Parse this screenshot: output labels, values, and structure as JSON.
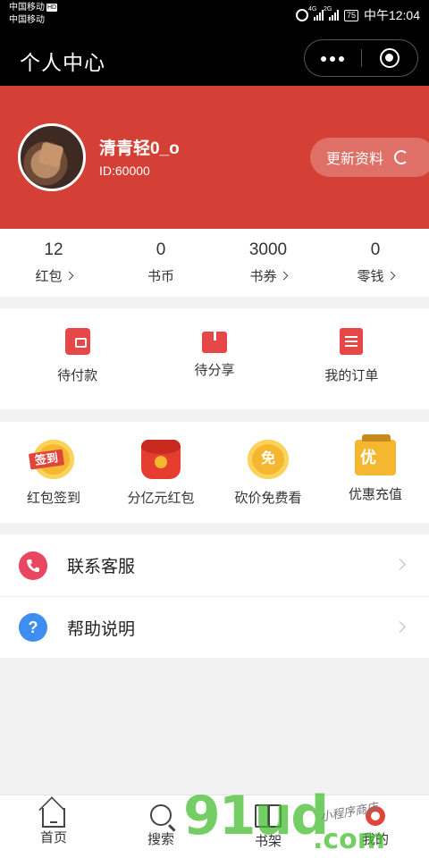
{
  "status_bar": {
    "carrier1": "中国移动",
    "hd": "HD",
    "carrier2": "中国移动",
    "net1": "4G",
    "net2": "2G",
    "battery": "75",
    "time": "中午12:04"
  },
  "title_bar": {
    "title": "个人中心"
  },
  "profile": {
    "username": "清青轻0_o",
    "user_id": "ID:60000",
    "update_label": "更新资料"
  },
  "stats": [
    {
      "value": "12",
      "label": "红包"
    },
    {
      "value": "0",
      "label": "书币"
    },
    {
      "value": "3000",
      "label": "书券"
    },
    {
      "value": "0",
      "label": "零钱"
    }
  ],
  "orders": [
    {
      "label": "待付款",
      "icon": "wallet-icon"
    },
    {
      "label": "待分享",
      "icon": "share-icon"
    },
    {
      "label": "我的订单",
      "icon": "order-list-icon"
    }
  ],
  "promos": [
    {
      "label": "红包签到",
      "badge": "签到",
      "icon": "sign-in-coin-icon"
    },
    {
      "label": "分亿元红包",
      "icon": "red-envelope-icon"
    },
    {
      "label": "砍价免费看",
      "badge": "免",
      "icon": "free-coin-icon"
    },
    {
      "label": "优惠充值",
      "badge": "优",
      "icon": "discount-ticket-icon"
    }
  ],
  "menu": [
    {
      "label": "联系客服",
      "icon": "phone-icon",
      "color": "#e8475f"
    },
    {
      "label": "帮助说明",
      "icon": "help-icon",
      "color": "#3d8ef0",
      "glyph": "?"
    }
  ],
  "tab_bar": [
    {
      "label": "首页",
      "icon": "home-icon"
    },
    {
      "label": "搜索",
      "icon": "search-icon"
    },
    {
      "label": "书架",
      "icon": "bookshelf-icon"
    },
    {
      "label": "我的",
      "icon": "profile-icon",
      "active": true
    }
  ],
  "watermark": {
    "text1": "91ud",
    "text2": ".com",
    "text3": "小程序商店"
  },
  "colors": {
    "brand_red": "#d54036",
    "accent_red": "#e84747",
    "gold": "#f6b730"
  }
}
